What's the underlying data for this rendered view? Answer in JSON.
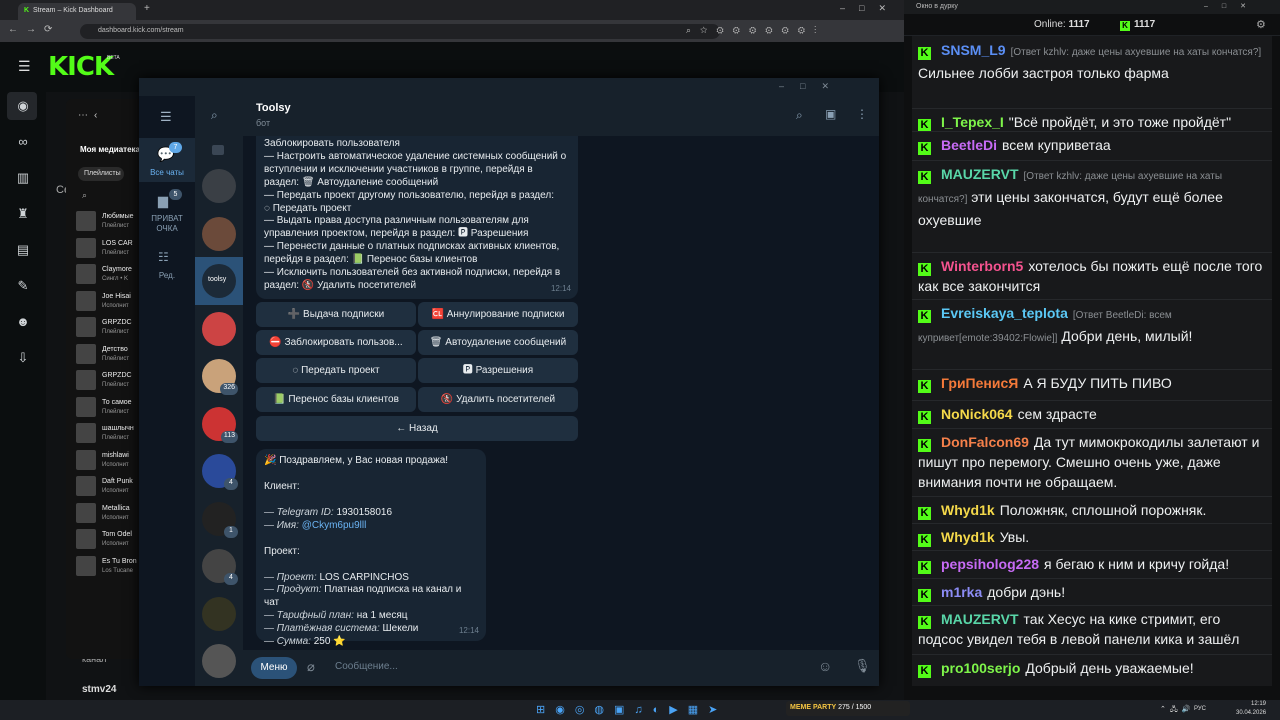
{
  "browser": {
    "tab_title": "Stream – Kick Dashboard",
    "url": "dashboard.kick.com/stream",
    "logo": "KICK",
    "beta": "BETA",
    "left_hint": "Се",
    "bottom_user": "stmv24",
    "bottom_label": "канал"
  },
  "spotify": {
    "title": "Моя медиатека",
    "filter": "Плейлисты",
    "items": [
      {
        "t": "Любимые",
        "s": "Плейлист"
      },
      {
        "t": "LOS CAR",
        "s": "Плейлист"
      },
      {
        "t": "Claymore",
        "s": "Сингл • K"
      },
      {
        "t": "Joe Hisai",
        "s": "Исполнит"
      },
      {
        "t": "GRPZDC",
        "s": "Плейлист"
      },
      {
        "t": "Детство",
        "s": "Плейлист"
      },
      {
        "t": "GRPZDC",
        "s": "Плейлист"
      },
      {
        "t": "То самое",
        "s": "Плейлист"
      },
      {
        "t": "шашлычн",
        "s": "Плейлист"
      },
      {
        "t": "mishlawi",
        "s": "Исполнит"
      },
      {
        "t": "Daft Punk",
        "s": "Исполнит"
      },
      {
        "t": "Metallica",
        "s": "Исполнит"
      },
      {
        "t": "Tom Odel",
        "s": "Исполнит"
      },
      {
        "t": "Es Tu Bron",
        "s": "Los Tucane"
      }
    ]
  },
  "telegram": {
    "chat_name": "Toolsy",
    "chat_status": "бот",
    "nav": {
      "all": "Все чаты",
      "all_count": "7",
      "private": "ПРИВАТ ОЧКА",
      "private_count": "5",
      "edit": "Ред."
    },
    "avatars": [
      {
        "badge": ""
      },
      {
        "badge": ""
      },
      {
        "badge": ""
      },
      {
        "badge": ""
      },
      {
        "badge": "326"
      },
      {
        "badge": "113"
      },
      {
        "badge": "4"
      },
      {
        "badge": "1"
      },
      {
        "badge": "4"
      },
      {
        "badge": ""
      },
      {
        "badge": ""
      }
    ],
    "msg1": {
      "lines": [
        "Заблокировать пользователя",
        "— Настроить автоматическое удаление системных сообщений о",
        "вступлении и исключении участников в группе, перейдя в",
        "раздел: 🗑 Автоудаление сообщений",
        "— Передать проект другому пользователю, перейдя в раздел:",
        "◌ Передать проект",
        "— Выдать права доступа различным пользователям для",
        "управления проектом, перейдя в раздел: 🅿 Разрешения",
        "— Перенести данные о платных подписках активных клиентов,",
        "перейдя в раздел: 📗 Перенос базы клиентов",
        "— Исключить пользователей без активной подписки, перейдя в",
        "раздел: 🚷 Удалить посетителей"
      ],
      "time": "12:14"
    },
    "buttons": [
      "➕ Выдача подписки",
      "🆑 Аннулирование подписки",
      "⛔ Заблокировать пользов...",
      "🗑 Автоудаление сообщений",
      "◌ Передать проект",
      "🅿 Разрешения",
      "📗 Перенос базы клиентов",
      "🚷 Удалить посетителей",
      "← Назад"
    ],
    "msg2": {
      "congrats": "🎉 Поздравляем, у Вас новая продажа!",
      "client_h": "Клиент:",
      "tg_label": "— Telegram ID:",
      "tg_id": "1930158016",
      "name_label": "— Имя:",
      "name_val": "@Ckym6pu9lll",
      "project_h": "Проект:",
      "proj_label": "— Проект:",
      "proj_val": "LOS CARPINCHOS",
      "prod_label": "— Продукт:",
      "prod_val": "Платная подписка на канал и чат",
      "plan_label": "— Тарифный план:",
      "plan_val": "на 1 месяц",
      "pay_label": "— Платёжная система:",
      "pay_val": "Шекели",
      "sum_label": "— Сумма:",
      "sum_val": "250 ⭐",
      "time": "12:14"
    },
    "menu_btn": "Меню",
    "input_placeholder": "Сообщение..."
  },
  "chat": {
    "window_title": "Окно в дурку",
    "online_label": "Online:",
    "online_val": "1117",
    "k_val": "1117",
    "messages": [
      {
        "user": "SNSM_L9",
        "color": "#5b8ff5",
        "reply": "[Ответ kzhlv: даже цены ахуевшие на хаты кончатся?]",
        "text": "Сильнее лобби застроя только фарма"
      },
      {
        "user": "I_Tepex_I",
        "color": "#7ef54a",
        "reply": "",
        "text": "\"Всё пройдёт, и это тоже пройдёт\""
      },
      {
        "user": "BeetleDi",
        "color": "#c76bf5",
        "reply": "",
        "text": "всем куприветaa"
      },
      {
        "user": "MAUZERVT",
        "color": "#59d6a8",
        "reply": "[Ответ kzhlv: даже цены ахуевшие на хаты кончатся?]",
        "text": "эти цены закончатся, будут ещё более охуевшие"
      },
      {
        "user": "Winterborn5",
        "color": "#f5538f",
        "reply": "",
        "text": "хотелось бы пожить ещё после того как все закончится"
      },
      {
        "user": "Evreiskaya_teplota",
        "color": "#5bc8f5",
        "reply": "[Ответ BeetleDi: всем купривет[emote:39402:Flowie]]",
        "text": "Добри день, милый!"
      },
      {
        "user": "ГриПенисЯ",
        "color": "#f57a3a",
        "reply": "",
        "text": "А Я БУДУ ПИТЬ ПИВО"
      },
      {
        "user": "NoNick064",
        "color": "#f5d94a",
        "reply": "",
        "text": "сем здрасте"
      },
      {
        "user": "DonFalcon69",
        "color": "#f5804a",
        "reply": "",
        "text": "Да тут мимокрокодилы залетают и пишут про перемогу. Смешно очень уже, даже внимания почти не обращаем."
      },
      {
        "user": "Whyd1k",
        "color": "#f5d94a",
        "reply": "",
        "text": "Положняк, сплошной порожняк."
      },
      {
        "user": "Whyd1k",
        "color": "#f5d94a",
        "reply": "",
        "text": "Увы."
      },
      {
        "user": "pepsiholog228",
        "color": "#c76bf5",
        "reply": "",
        "text": "я бегаю к ним и кричу гойда!"
      },
      {
        "user": "m1rka",
        "color": "#8c8cf5",
        "reply": "",
        "text": "добри дэнь!"
      },
      {
        "user": "MAUZERVT",
        "color": "#59d6a8",
        "reply": "",
        "text": "так Хесус на кике стримит, его подсос увидел тебя в левой панели кика и зашёл"
      },
      {
        "user": "pro100serjo",
        "color": "#7ef54a",
        "reply": "",
        "text": "Добрый день уважаемые!"
      }
    ]
  },
  "taskbar": {
    "lang": "РУС",
    "time": "12:19",
    "date": "30.04.2026",
    "meme": "MEME PARTY",
    "meme_count": "275 / 1500"
  }
}
